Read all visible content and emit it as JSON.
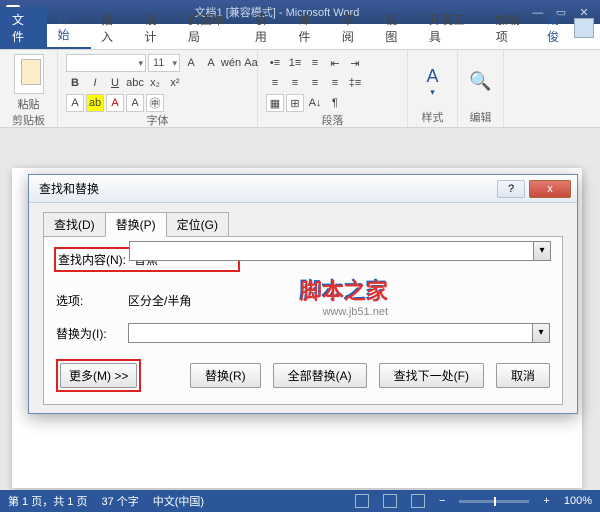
{
  "app": {
    "title": "文档1 [兼容模式] - Microsoft Word",
    "user": "胡俊"
  },
  "tabs": {
    "file": "文件",
    "home": "开始",
    "insert": "插入",
    "design": "设计",
    "layout": "页面布局",
    "ref": "引用",
    "mail": "邮件",
    "review": "审阅",
    "view": "视图",
    "dev": "开发工具",
    "addins": "加载项"
  },
  "ribbon": {
    "clipboard": {
      "paste": "粘贴",
      "label": "剪贴板"
    },
    "font": {
      "label": "字体",
      "size": "11",
      "wen": "wén",
      "a1": "A",
      "bold": "B",
      "italic": "I",
      "underline": "U"
    },
    "para": {
      "label": "段落"
    },
    "styles": {
      "label": "样式",
      "btn": "A"
    },
    "editing": {
      "label": "编辑"
    }
  },
  "dialog": {
    "title": "查找和替换",
    "tabs": {
      "find": "查找(D)",
      "replace": "替换(P)",
      "goto": "定位(G)"
    },
    "findLabel": "查找内容(N):",
    "findValue": "香蕉",
    "optsLabel": "选项:",
    "optsValue": "区分全/半角",
    "replaceLabel": "替换为(I):",
    "replaceValue": "",
    "buttons": {
      "more": "更多(M) >>",
      "replace": "替换(R)",
      "replaceAll": "全部替换(A)",
      "findNext": "查找下一处(F)",
      "cancel": "取消"
    },
    "help": "?",
    "close": "x"
  },
  "status": {
    "page": "第 1 页，共 1 页",
    "words": "37 个字",
    "lang": "中文(中国)",
    "zoom": "100%",
    "minus": "−",
    "plus": "+"
  },
  "watermark": {
    "main": "脚本之家",
    "sub": "www.jb51.net"
  }
}
